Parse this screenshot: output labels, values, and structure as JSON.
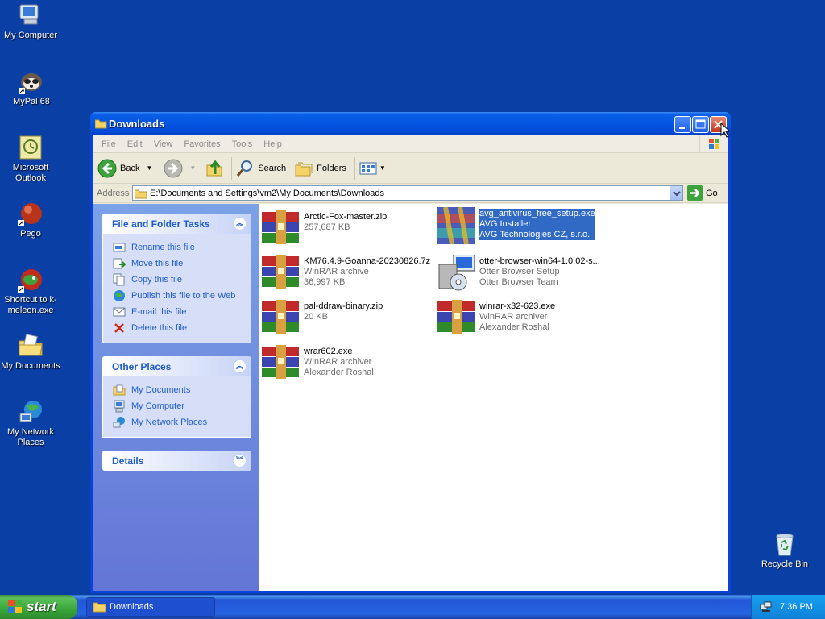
{
  "desktop": {
    "icons": [
      {
        "label": "My Computer",
        "icon": "my-computer-icon"
      },
      {
        "label": "MyPal 68",
        "icon": "mypal-icon"
      },
      {
        "label": "Microsoft Outlook",
        "icon": "outlook-icon"
      },
      {
        "label": "Pego",
        "icon": "pego-icon"
      },
      {
        "label": "Shortcut to k-meleon.exe",
        "icon": "k-meleon-icon"
      },
      {
        "label": "My Documents",
        "icon": "my-documents-icon"
      },
      {
        "label": "My Network Places",
        "icon": "network-places-icon"
      },
      {
        "label": "Recycle Bin",
        "icon": "recycle-bin-icon"
      }
    ]
  },
  "window": {
    "title": "Downloads",
    "menu": [
      "File",
      "Edit",
      "View",
      "Favorites",
      "Tools",
      "Help"
    ],
    "toolbar": {
      "back": "Back",
      "search": "Search",
      "folders": "Folders"
    },
    "address": {
      "label": "Address",
      "path": "E:\\Documents and Settings\\vm2\\My Documents\\Downloads",
      "go": "Go"
    }
  },
  "taskpane": {
    "file_tasks": {
      "title": "File and Folder Tasks",
      "links": [
        "Rename this file",
        "Move this file",
        "Copy this file",
        "Publish this file to the Web",
        "E-mail this file",
        "Delete this file"
      ]
    },
    "other_places": {
      "title": "Other Places",
      "links": [
        "My Documents",
        "My Computer",
        "My Network Places"
      ]
    },
    "details": {
      "title": "Details"
    }
  },
  "files": [
    {
      "name": "Arctic-Fox-master.zip",
      "line2": "257,687 KB",
      "line3": "",
      "icon": "winrar-archive-icon"
    },
    {
      "name": "avg_antivirus_free_setup.exe",
      "line2": "AVG Installer",
      "line3": "AVG Technologies CZ, s.r.o.",
      "icon": "avg-installer-icon",
      "selected": true
    },
    {
      "name": "KM76.4.9-Goanna-20230826.7z",
      "line2": "WinRAR archive",
      "line3": "36,997 KB",
      "icon": "winrar-archive-icon"
    },
    {
      "name": "otter-browser-win64-1.0.02-s...",
      "line2": "Otter Browser Setup",
      "line3": "Otter Browser Team",
      "icon": "setup-installer-icon"
    },
    {
      "name": "pal-ddraw-binary.zip",
      "line2": "20 KB",
      "line3": "",
      "icon": "winrar-archive-icon"
    },
    {
      "name": "winrar-x32-623.exe",
      "line2": "WinRAR archiver",
      "line3": "Alexander Roshal",
      "icon": "winrar-archive-icon"
    },
    {
      "name": "wrar602.exe",
      "line2": "WinRAR archiver",
      "line3": "Alexander Roshal",
      "icon": "winrar-archive-icon"
    }
  ],
  "taskbar": {
    "start": "start",
    "task": "Downloads",
    "clock": "7:36 PM"
  }
}
